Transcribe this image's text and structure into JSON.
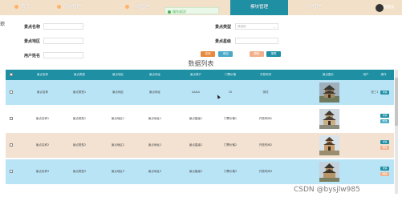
{
  "nav": {
    "items": [
      "首页",
      "网站管理",
      "人员管理",
      "模块管理",
      "个人管理"
    ],
    "active_index": 3,
    "toast": "操作成功!",
    "user": "管理员"
  },
  "filters": {
    "left_cut": "琮",
    "name_label": "景点名称",
    "area_label": "景点地区",
    "user_label": "用户姓名",
    "type_label": "景点类型",
    "type_placeholder": "请选择",
    "level_label": "景点星级",
    "search_btn": "查询",
    "add_btn": "添加",
    "delete_btn": "删除",
    "export_btn": "报表"
  },
  "section_title": "数据列表",
  "table": {
    "headers": [
      "景点名称",
      "景点类型",
      "景点地区",
      "景点地址",
      "景点简介",
      "门票价格",
      "开放时间",
      "景点图片",
      "用户",
      "操作"
    ],
    "rows": [
      [
        "景点名称",
        "景点类型1",
        "景点地区",
        "景点地址",
        "AAAA",
        "10",
        "测试",
        "",
        "张三1"
      ],
      [
        "景点名称1",
        "景点类型1",
        "景点地区1",
        "景点地址1",
        "景点星级1",
        "门票价格1",
        "开放时间1",
        "",
        ""
      ],
      [
        "景点名称2",
        "景点类型2",
        "景点地区2",
        "景点地址2",
        "景点星级2",
        "门票价格2",
        "开放时间2",
        "",
        ""
      ],
      [
        "景点名称3",
        "景点类型3",
        "景点地区3",
        "景点地址3",
        "景点星级3",
        "门票价格3",
        "开放时间3",
        "",
        ""
      ]
    ],
    "action_detail": "详情",
    "action_edit": "修改",
    "action_delete": "删除"
  },
  "watermark": "CSDN @bysjlw985"
}
